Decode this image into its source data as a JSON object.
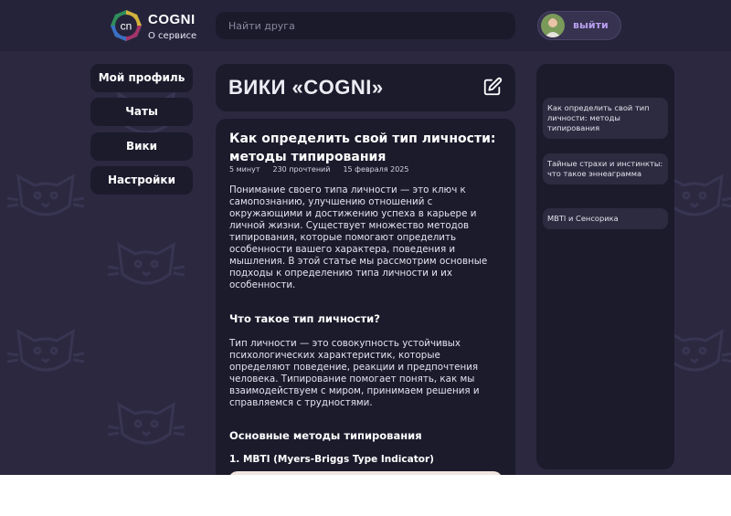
{
  "header": {
    "brand_title": "COGNI",
    "logo_text": "cn",
    "about_link": "О сервисе",
    "search_placeholder": "Найти друга",
    "logout_label": "выйти"
  },
  "nav": {
    "items": [
      {
        "label": "Мой профиль"
      },
      {
        "label": "Чаты"
      },
      {
        "label": "Вики"
      },
      {
        "label": "Настройки"
      }
    ]
  },
  "wiki": {
    "title": "ВИКИ «COGNI»"
  },
  "article": {
    "title": "Как определить свой тип личности: методы типирования",
    "read_time": "5 минут",
    "views": "230 прочтений",
    "date": "15 февраля 2025",
    "intro": "Понимание своего типа личности — это ключ к самопознанию, улучшению отношений с окружающими и достижению успеха в карьере и личной жизни. Существует множество методов типирования, которые помогают определить особенности вашего характера, поведения и мышления. В этой статье мы рассмотрим основные подходы к определению типа личности и их особенности.",
    "section1_heading": "Что такое тип личности?",
    "section1_text": "Тип личности — это совокупность устойчивых психологических характеристик, которые определяют поведение, реакции и предпочтения человека. Типирование помогает понять, как мы взаимодействуем с миром, принимаем решения и справляемся с трудностями.",
    "section2_heading": "Основные методы типирования",
    "subsection1_heading": "1. MBTI (Myers-Briggs Type Indicator)"
  },
  "related": {
    "items": [
      {
        "label": "Как определить свой тип личности: методы типирования"
      },
      {
        "label": "Тайные страхи и инстинкты: что такое эннеаграмма"
      },
      {
        "label": "MBTI и Сенсорика"
      }
    ]
  },
  "colors": {
    "background": "#2b2840",
    "header": "#25233a",
    "card": "#1c1b2c",
    "accent": "#b89ff0"
  }
}
